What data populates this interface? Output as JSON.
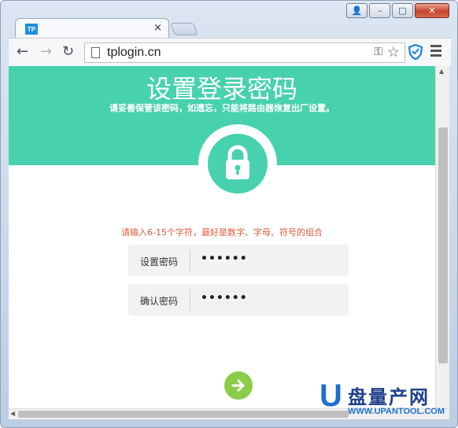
{
  "browser": {
    "tab_favicon_text": "TP",
    "tab_close": "×",
    "url": "tplogin.cn",
    "back_glyph": "←",
    "forward_glyph": "→",
    "reload_glyph": "↻",
    "key_glyph": "⚿",
    "star_glyph": "☆",
    "controls": {
      "user": "👤",
      "minimize": "–",
      "maximize": "□",
      "close": "✕"
    }
  },
  "page": {
    "title": "设置登录密码",
    "subtitle": "请妥善保管该密码，如遗忘，只能将路由器恢复出厂设置。",
    "hint": "请输入6-15个字符，最好是数字、字母、符号的组合",
    "fields": [
      {
        "label": "设置密码",
        "value": "••••••"
      },
      {
        "label": "确认密码",
        "value": "••••••"
      }
    ],
    "accent": "#48d1ad",
    "hint_color": "#e05a3b",
    "button_color": "#8ccc4b"
  },
  "watermark": {
    "letter": "U",
    "cn": "盘量产网",
    "en": "WWW.UPANTOOL.COM"
  }
}
